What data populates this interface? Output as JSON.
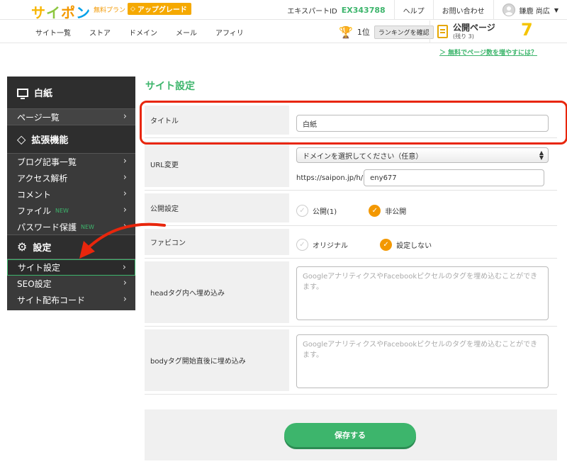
{
  "header": {
    "logo": [
      "サ",
      "イ",
      "ポ",
      "ン"
    ],
    "plan": "無料プラン",
    "upgrade": "アップグレード",
    "expert_label": "エキスパートID",
    "expert_id": "EX343788",
    "help": "ヘルプ",
    "contact": "お問い合わせ",
    "user": "鎌鹿 尚広"
  },
  "nav": {
    "links": [
      "サイト一覧",
      "ストア",
      "ドメイン",
      "メール",
      "アフィリ"
    ],
    "rank": "1位",
    "rank_button": "ランキングを確認",
    "pages_label": "公開ページ",
    "pages_sub": "(残り 3)",
    "pages_count": "7",
    "more_link": "＞ 無料でページ数を増やすには？"
  },
  "sidebar": {
    "site_name": "白紙",
    "page_list": "ページ一覧",
    "ext_head": "拡張機能",
    "ext_items": [
      {
        "label": "ブログ記事一覧",
        "new": ""
      },
      {
        "label": "アクセス解析",
        "new": ""
      },
      {
        "label": "コメント",
        "new": ""
      },
      {
        "label": "ファイル",
        "new": "NEW"
      },
      {
        "label": "パスワード保護",
        "new": "NEW"
      }
    ],
    "settings_head": "設定",
    "settings_items": [
      "サイト設定",
      "SEO設定",
      "サイト配布コード"
    ]
  },
  "main": {
    "title": "サイト設定",
    "title_label": "タイトル",
    "title_value": "白紙",
    "url_label": "URL変更",
    "domain_select": "ドメインを選択してください（任意）",
    "url_prefix": "https://saipon.jp/h/",
    "url_value": "eny677",
    "public_label": "公開設定",
    "public_opt1": "公開(1)",
    "public_opt2": "非公開",
    "favicon_label": "ファビコン",
    "favicon_opt1": "オリジナル",
    "favicon_opt2": "設定しない",
    "head_label": "headタグ内へ埋め込み",
    "head_placeholder": "GoogleアナリティクスやFacebookピクセルのタグを埋め込むことができます。",
    "body_label": "bodyタグ開始直後に埋め込み",
    "body_placeholder": "GoogleアナリティクスやFacebookピクセルのタグを埋め込むことができます。",
    "save": "保存する"
  },
  "colors": {
    "accent_green": "#3db56c",
    "annotation_red": "#e8260c",
    "check_orange": "#f39800"
  }
}
